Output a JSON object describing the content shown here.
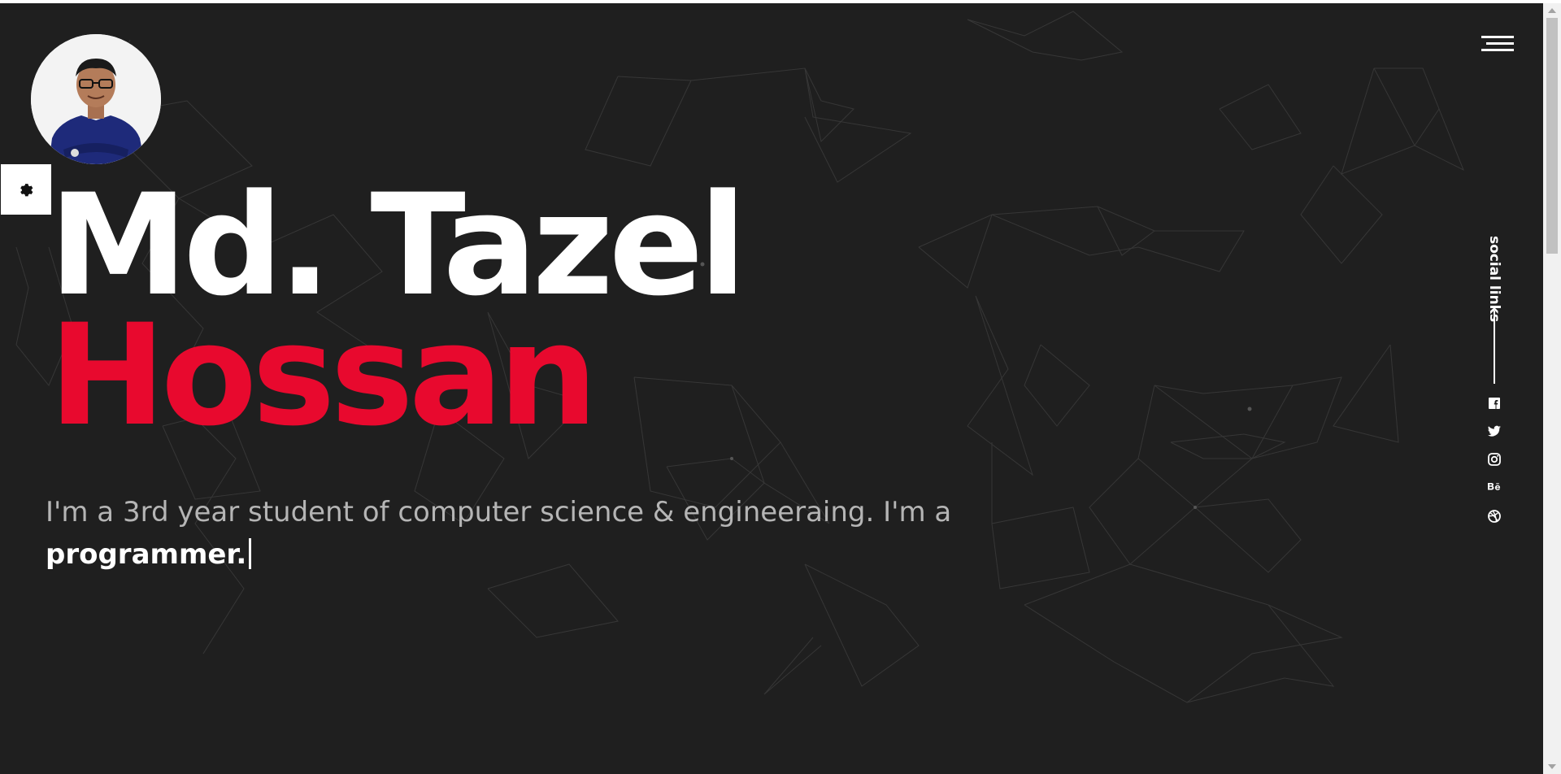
{
  "profile": {
    "first_name": "Md. Tazel",
    "last_name": "Hossan",
    "intro_text": "I'm a 3rd year student of computer science & engineeraing. I'm a",
    "typed_role": "programmer."
  },
  "social": {
    "label": "social links",
    "icons": [
      "facebook-icon",
      "twitter-icon",
      "instagram-icon",
      "behance-icon",
      "dribbble-icon"
    ]
  },
  "colors": {
    "background": "#1f1f1f",
    "accent": "#e8092e",
    "text": "#ffffff",
    "muted_text": "#b5b5b5"
  },
  "controls": {
    "menu_icon": "hamburger-menu-icon",
    "settings_icon": "gear-icon"
  }
}
